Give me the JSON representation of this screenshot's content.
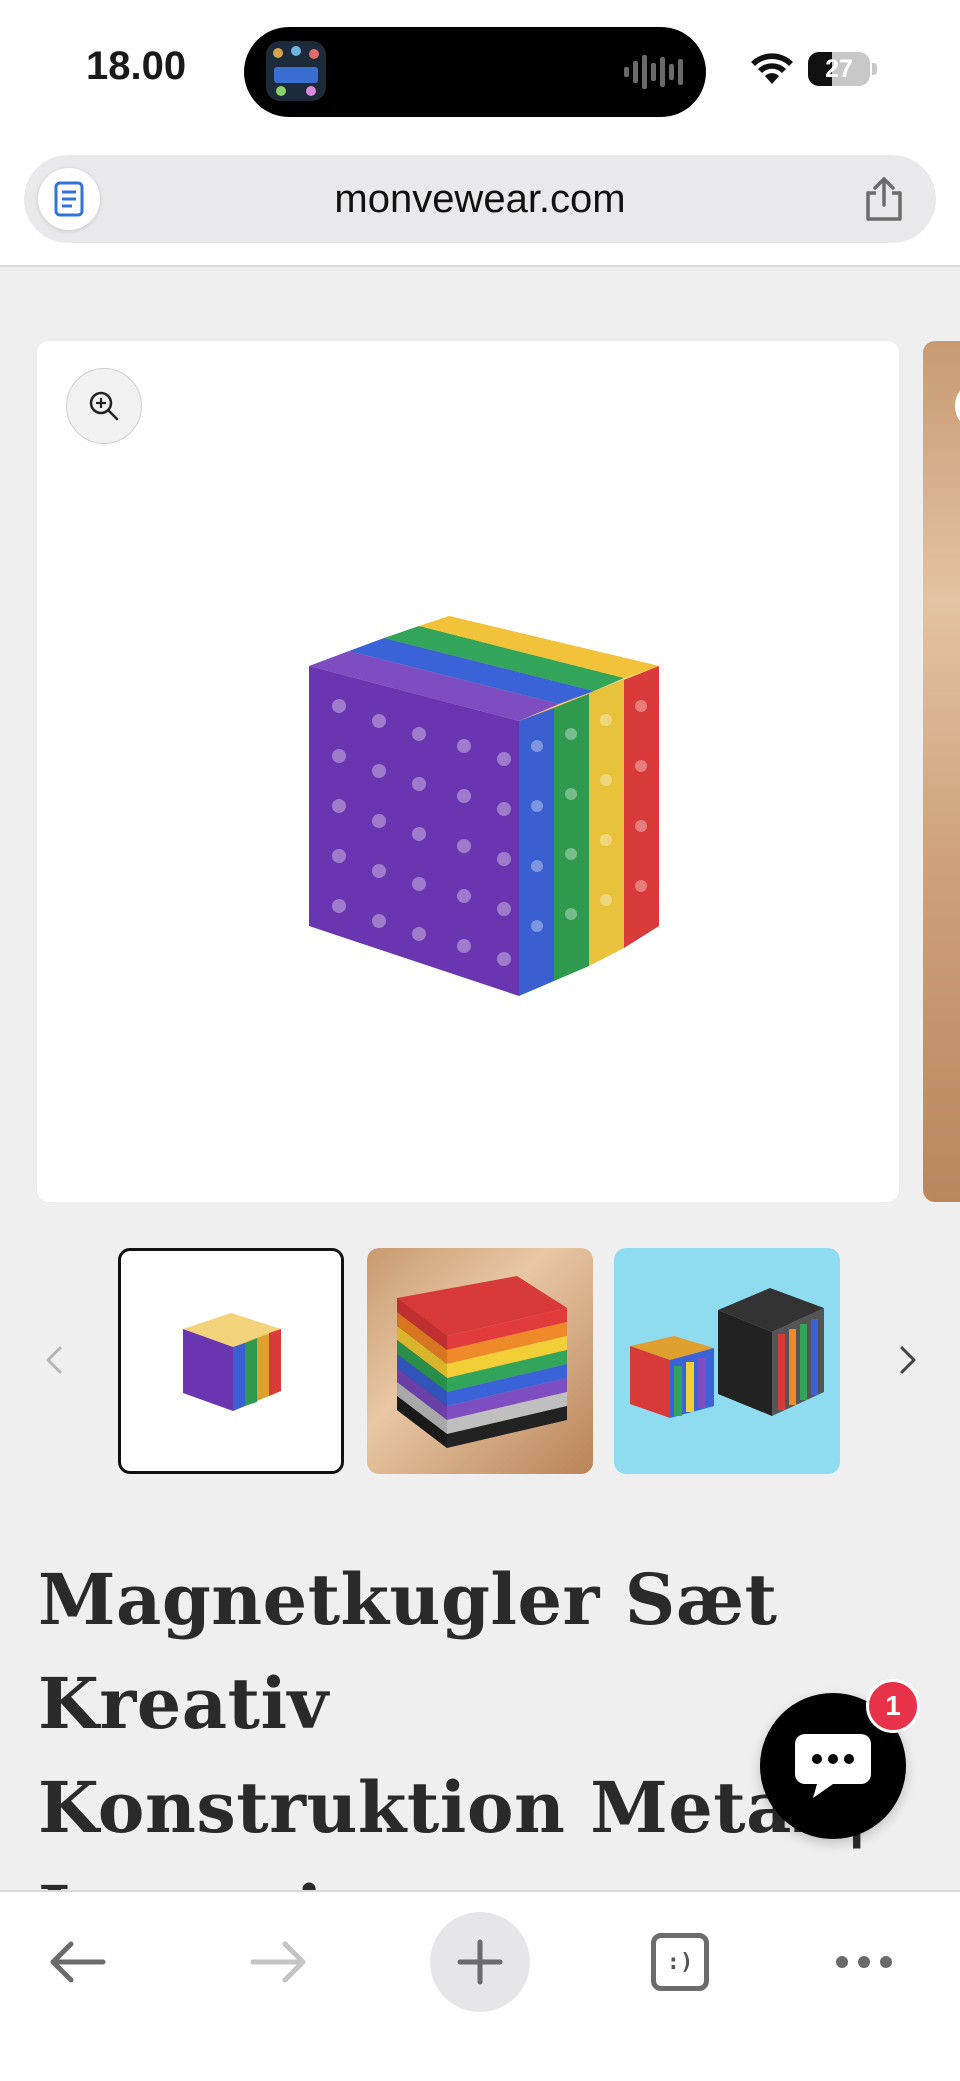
{
  "status_bar": {
    "time": "18.00",
    "battery_level": "27"
  },
  "browser": {
    "url": "monvewear.com"
  },
  "gallery": {
    "selected_index": 0,
    "thumbnails": [
      "magnet-cube-rainbow",
      "magnet-cube-stacked-layers",
      "magnet-cubes-blue-background"
    ]
  },
  "product": {
    "title_line1": "Magnetkugler Sæt Kreativ",
    "title_line2": "Konstruktion Metal |",
    "title_line3": "Lumerio"
  },
  "chat": {
    "badge_count": "1"
  },
  "toolbar": {
    "tabs_icon_glyph": ":)"
  },
  "colors": {
    "page_background": "#efefef",
    "badge": "#e8324a",
    "reader_icon": "#2f74d6",
    "toolbar_icon": "#6b6b6b"
  },
  "icons": {
    "reader": "reader-mode-icon",
    "share": "share-icon",
    "zoom": "zoom-in-icon",
    "back": "back-arrow-icon",
    "forward": "forward-arrow-icon",
    "new_tab": "plus-icon",
    "tabs": "tabs-icon",
    "more": "more-icon",
    "chat": "chat-bubble-icon"
  }
}
